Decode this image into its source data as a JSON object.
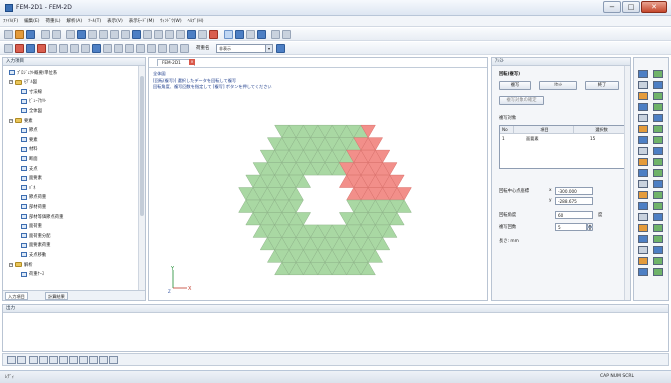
{
  "window": {
    "title": "FEM-2D1 - FEM-2D",
    "min": "−",
    "max": "□",
    "close": "✕"
  },
  "menu": [
    "ﾌｧｲﾙ(F)",
    "編集(E)",
    "荷重(L)",
    "解析(A)",
    "ﾂｰﾙ(T)",
    "表示(V)",
    "表示ﾓｰﾄﾞ(M)",
    "ｳｨﾝﾄﾞｳ(W)",
    "ﾍﾙﾌﾟ(H)"
  ],
  "toolbar2": {
    "combo_label": "荷重名",
    "combo_value": "非表示"
  },
  "left_panel": {
    "title": "入力項目",
    "tree": [
      {
        "label": "ﾌﾟﾛｼﾞｪｸﾄ概要/単位系",
        "level": 0,
        "kind": "item"
      },
      {
        "label": "ﾓﾃﾞﾙ図",
        "level": 0,
        "kind": "folder",
        "exp": "−"
      },
      {
        "label": "寸法線",
        "level": 1,
        "kind": "item"
      },
      {
        "label": "ﾋﾞｭｰｱｶﾘﾄ",
        "level": 1,
        "kind": "item"
      },
      {
        "label": "全体図",
        "level": 1,
        "kind": "item"
      },
      {
        "label": "要素",
        "level": 0,
        "kind": "folder",
        "exp": "−"
      },
      {
        "label": "節点",
        "level": 1,
        "kind": "item"
      },
      {
        "label": "要素",
        "level": 1,
        "kind": "item"
      },
      {
        "label": "材料",
        "level": 1,
        "kind": "item"
      },
      {
        "label": "断面",
        "level": 1,
        "kind": "item"
      },
      {
        "label": "支点",
        "level": 1,
        "kind": "item"
      },
      {
        "label": "面要素",
        "level": 1,
        "kind": "item"
      },
      {
        "label": "ﾊﾞﾈ",
        "level": 1,
        "kind": "item"
      },
      {
        "label": "節点荷重",
        "level": 1,
        "kind": "item"
      },
      {
        "label": "部材荷重",
        "level": 1,
        "kind": "item"
      },
      {
        "label": "部材等価節点荷重",
        "level": 1,
        "kind": "item"
      },
      {
        "label": "面荷重",
        "level": 1,
        "kind": "item"
      },
      {
        "label": "面荷重分配",
        "level": 1,
        "kind": "item"
      },
      {
        "label": "面要素荷重",
        "level": 1,
        "kind": "item"
      },
      {
        "label": "支点移動",
        "level": 1,
        "kind": "item"
      },
      {
        "label": "解析",
        "level": 0,
        "kind": "folder",
        "exp": "−"
      },
      {
        "label": "荷重ｹｰｽ",
        "level": 1,
        "kind": "item"
      }
    ],
    "tabs": [
      "入力項目",
      "計算結果"
    ]
  },
  "document": {
    "tab": "FEM-2D1",
    "tab_close": "×",
    "view_name": "全体図",
    "hint_line1": "[回転(複写)] 選択したデータを回転して複写",
    "hint_line2": "回転角度、複写回数を指定して [複写] ボタンを押してください",
    "axis_y": "Y",
    "axis_x": "X",
    "axis_z": "Z"
  },
  "right_panel": {
    "title": "ｱｼｽﾄ",
    "section": "回転(複写)",
    "buttons": {
      "copy": "複写",
      "reset": "ﾘｾｯﾄ",
      "finish": "終了"
    },
    "confirm_button": "複写対象の確定",
    "target_title": "複写対象",
    "table_headers": [
      "No",
      "項目",
      "選択数"
    ],
    "table_rows": [
      [
        "1",
        "面要素",
        "15"
      ]
    ],
    "center_label": "回転中心点座標",
    "x_label": "x",
    "x_value": "-300.000",
    "y_label": "y",
    "y_value": "-288.675",
    "angle_label": "回転角度",
    "angle_value": "60",
    "angle_unit": "度",
    "count_label": "複写回数",
    "count_value": "5",
    "spin_up": "▲",
    "spin_down": "▼",
    "length_unit": "長さ: mm"
  },
  "output_panel": {
    "title": "出力"
  },
  "status": {
    "left": "ﾚﾃﾞｨ",
    "right": "CAP  NUM  SCRL"
  },
  "colors": {
    "mesh_green": "#a9d8a3",
    "mesh_red": "#f28f8a",
    "line": "#8fb48a"
  }
}
